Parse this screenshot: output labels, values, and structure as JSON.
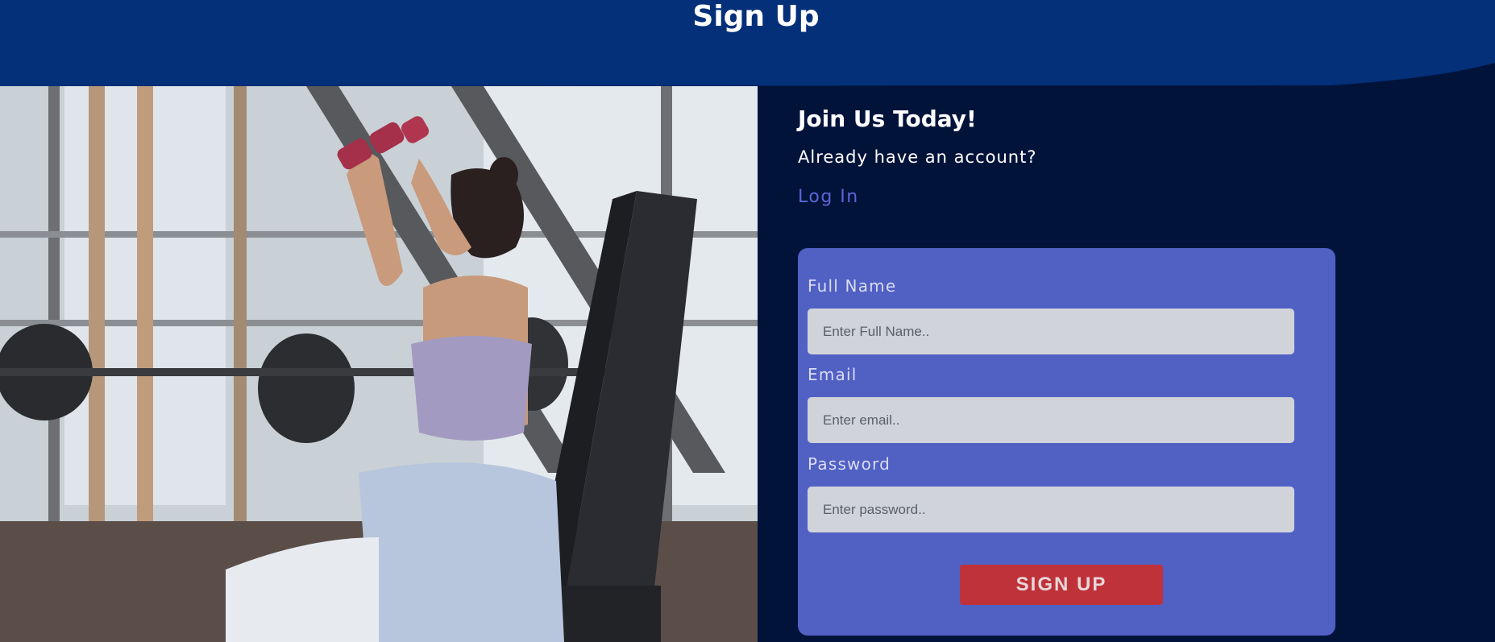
{
  "header": {
    "title": "Sign Up"
  },
  "intro": {
    "heading": "Join Us Today!",
    "account_prompt": "Already have an account?",
    "login_link": "Log In"
  },
  "form": {
    "full_name": {
      "label": "Full Name",
      "placeholder": "Enter Full Name.."
    },
    "email": {
      "label": "Email",
      "placeholder": "Enter email.."
    },
    "password": {
      "label": "Password",
      "placeholder": "Enter password.."
    },
    "submit_label": "SIGN UP"
  },
  "colors": {
    "header_bg": "#04307a",
    "page_bg": "#02133a",
    "card_bg": "#5160c3",
    "link": "#5a66d8",
    "button": "#c0323a"
  },
  "images": {
    "hero": "woman-lifting-dumbbells-in-gym-photo"
  }
}
